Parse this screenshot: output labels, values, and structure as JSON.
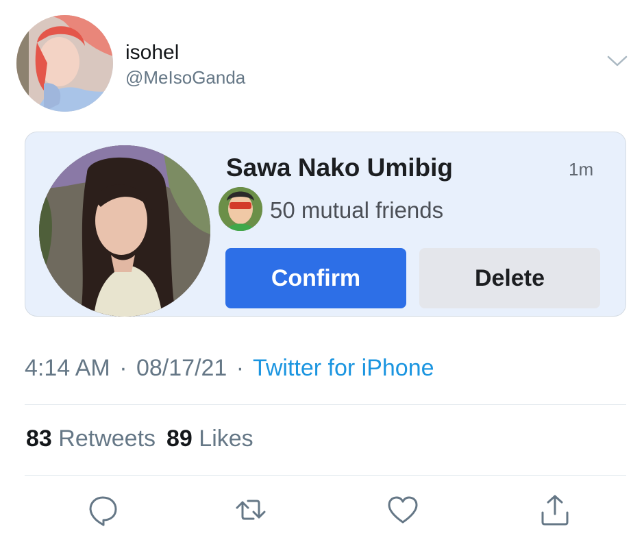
{
  "tweet": {
    "author": {
      "display_name": "isohel",
      "handle": "@MeIsoGanda"
    },
    "timestamp": {
      "time": "4:14 AM",
      "date": "08/17/21",
      "separator": "·",
      "source": "Twitter for iPhone"
    },
    "stats": {
      "retweets_count": "83",
      "retweets_label": "Retweets",
      "likes_count": "89",
      "likes_label": "Likes"
    },
    "actions": [
      "reply",
      "retweet",
      "like",
      "share"
    ]
  },
  "friend_request": {
    "name": "Sawa Nako Umibig",
    "time": "1m",
    "mutual": "50 mutual friends",
    "confirm_label": "Confirm",
    "delete_label": "Delete"
  },
  "colors": {
    "accent_link": "#1b95e0",
    "confirm_blue": "#2d6fe7",
    "card_bg": "#e8f0fc",
    "muted_text": "#657786"
  }
}
